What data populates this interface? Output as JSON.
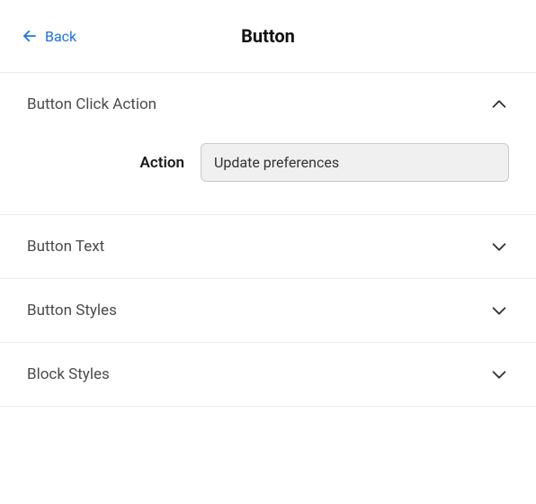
{
  "header": {
    "back_label": "Back",
    "title": "Button"
  },
  "sections": {
    "click_action": {
      "title": "Button Click Action",
      "expanded": true,
      "field_label": "Action",
      "selected_value": "Update preferences"
    },
    "button_text": {
      "title": "Button Text",
      "expanded": false
    },
    "button_styles": {
      "title": "Button Styles",
      "expanded": false
    },
    "block_styles": {
      "title": "Block Styles",
      "expanded": false
    }
  },
  "colors": {
    "link": "#1a73e8",
    "border": "#ebebeb",
    "select_bg": "#f0f0f0",
    "select_border": "#c9c9c9"
  }
}
